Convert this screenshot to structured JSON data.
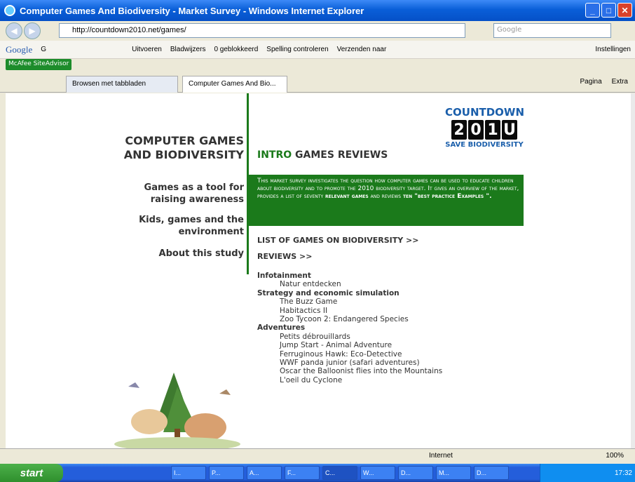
{
  "window": {
    "title": "Computer Games And Biodiversity - Market Survey - Windows Internet Explorer"
  },
  "address": {
    "url": "http://countdown2010.net/games/",
    "search_placeholder": "Google"
  },
  "googlebar": {
    "logo": "Google",
    "g_btn": "G",
    "run": "Uitvoeren",
    "bookmarks": "Bladwijzers",
    "blocked": "0 geblokkeerd",
    "spell": "Spelling controleren",
    "send": "Verzenden naar",
    "settings": "Instellingen"
  },
  "mcafee": "McAfee SiteAdvisor",
  "tabs": {
    "tab1": "Browsen met tabbladen",
    "tab2": "Computer Games And Bio...",
    "page_menu": "Pagina",
    "extra_menu": "Extra"
  },
  "site": {
    "title_line1": "COMPUTER GAMES",
    "title_line2": "AND BIODIVERSITY",
    "nav": [
      {
        "line1": "Games as a tool for",
        "line2": "raising awareness"
      },
      {
        "line1": "Kids, games and the",
        "line2": "environment"
      },
      {
        "line1": "About this study",
        "line2": ""
      }
    ],
    "logo": {
      "top": "COUNTDOWN",
      "digits": [
        "2",
        "0",
        "1",
        "U"
      ],
      "bottom": "SAVE BIODIVERSITY"
    },
    "header_intro": "INTRO",
    "header_rest": "GAMES REVIEWS",
    "intro_text": "This market survey investigates the question how computer games can be used to educate children about biodiversity and to promote the 2010 biodiversity target. It gives an overview of the market, provides a list of seventy",
    "intro_bold1": "relevant games",
    "intro_mid": "and reviews",
    "intro_bold2": "ten \"best practice Examples \".",
    "list_link": "LIST OF GAMES ON BIODIVERSITY >>",
    "reviews_link": "REVIEWS >>",
    "categories": [
      {
        "name": "Infotainment",
        "items": [
          "Natur entdecken"
        ]
      },
      {
        "name": "Strategy and economic simulation",
        "items": [
          "The Buzz Game",
          "Habitactics II",
          "Zoo Tycoon 2: Endangered Species"
        ]
      },
      {
        "name": "Adventures",
        "items": [
          "Petits débrouillards",
          "Jump Start - Animal Adventure",
          "Ferruginous Hawk: Eco-Detective",
          "WWF panda junior (safari adventures)",
          "Oscar the Balloonist flies into the Mountains",
          "L'oeil du Cyclone"
        ]
      }
    ]
  },
  "status": {
    "zone": "Internet",
    "zoom": "100%"
  },
  "taskbar": {
    "start": "start",
    "tasks": [
      "I...",
      "P...",
      "A...",
      "F...",
      "C...",
      "W...",
      "D...",
      "M...",
      "D..."
    ],
    "clock": "17:32"
  }
}
